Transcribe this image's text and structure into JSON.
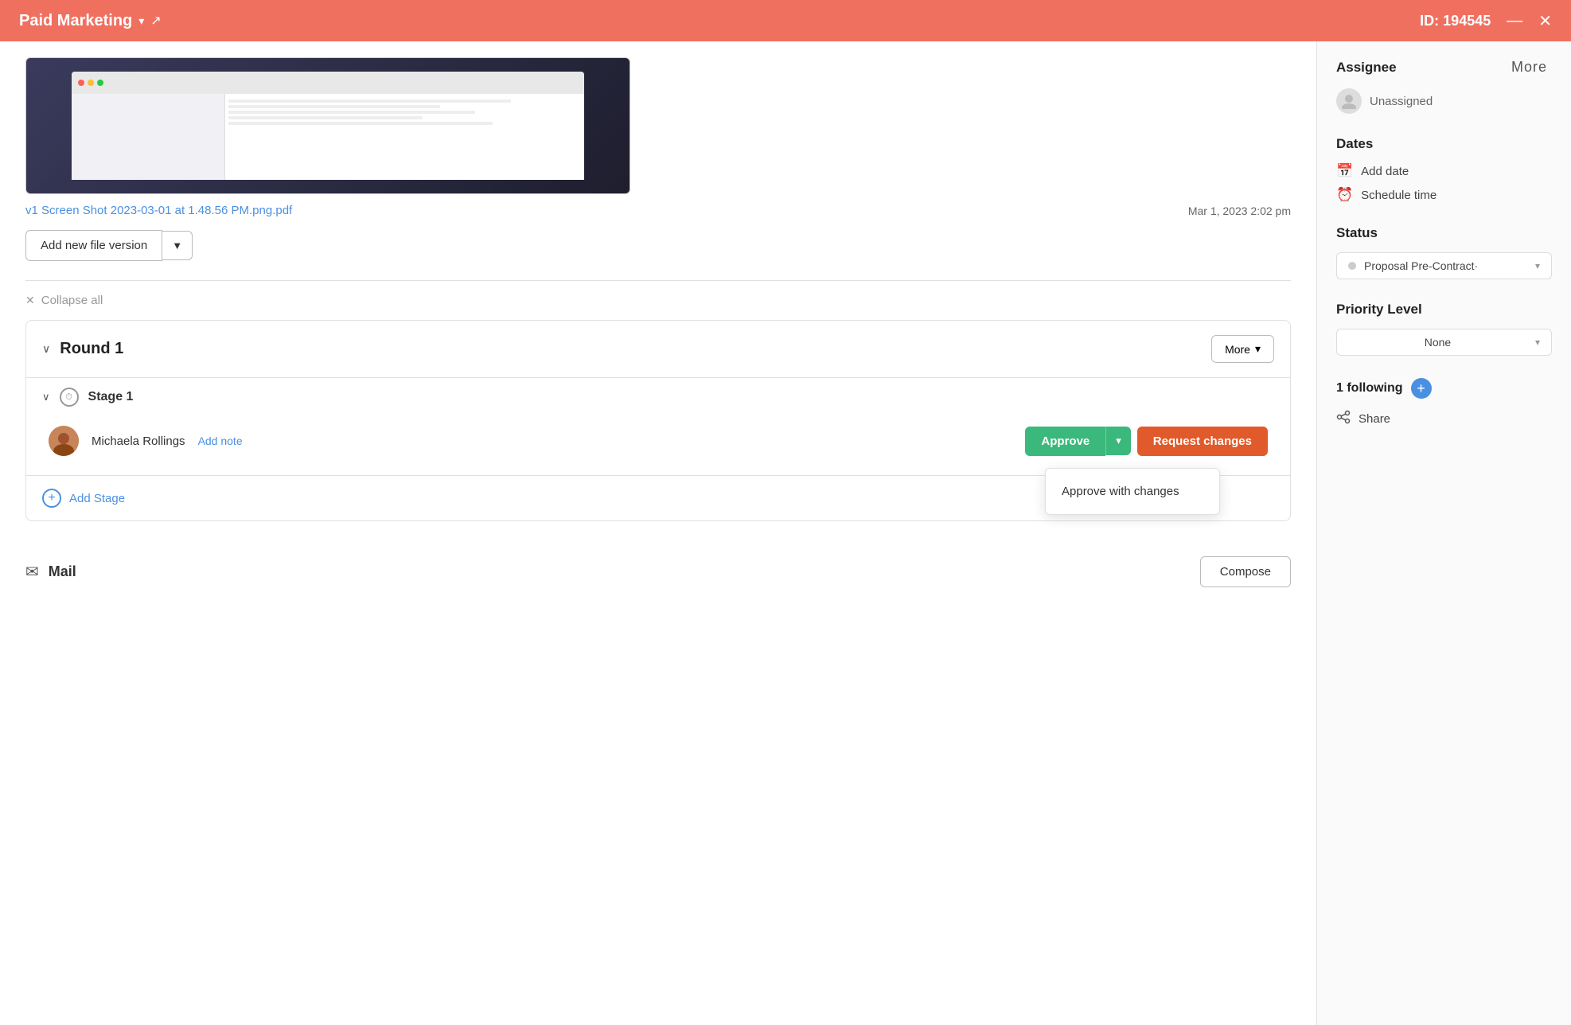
{
  "topbar": {
    "title": "Paid Marketing",
    "id_label": "ID: 194545",
    "minimize": "—",
    "close": "✕",
    "more_label": "More"
  },
  "file": {
    "link_text": "v1 Screen Shot 2023-03-01 at 1.48.56 PM.png.pdf",
    "date": "Mar 1, 2023 2:02 pm",
    "add_version_label": "Add new file version",
    "dropdown_arrow": "▼"
  },
  "collapse": {
    "label": "Collapse all"
  },
  "round": {
    "title": "Round 1",
    "more_label": "More"
  },
  "stage": {
    "title": "Stage 1"
  },
  "reviewer": {
    "name": "Michaela Rollings",
    "add_note": "Add note",
    "approve_label": "Approve",
    "request_changes_label": "Request changes",
    "approve_with_changes_label": "Approve with changes"
  },
  "add_stage": {
    "label": "Add Stage"
  },
  "mail": {
    "label": "Mail",
    "compose_label": "Compose"
  },
  "sidebar": {
    "more_label": "More",
    "assignee": {
      "section_title": "Assignee",
      "value": "Unassigned"
    },
    "dates": {
      "section_title": "Dates",
      "add_date": "Add date",
      "schedule_time": "Schedule time"
    },
    "status": {
      "section_title": "Status",
      "value": "Proposal Pre-Contract·"
    },
    "priority": {
      "section_title": "Priority Level",
      "value": "None"
    },
    "following": {
      "count_label": "1 following"
    },
    "share": {
      "label": "Share"
    }
  }
}
